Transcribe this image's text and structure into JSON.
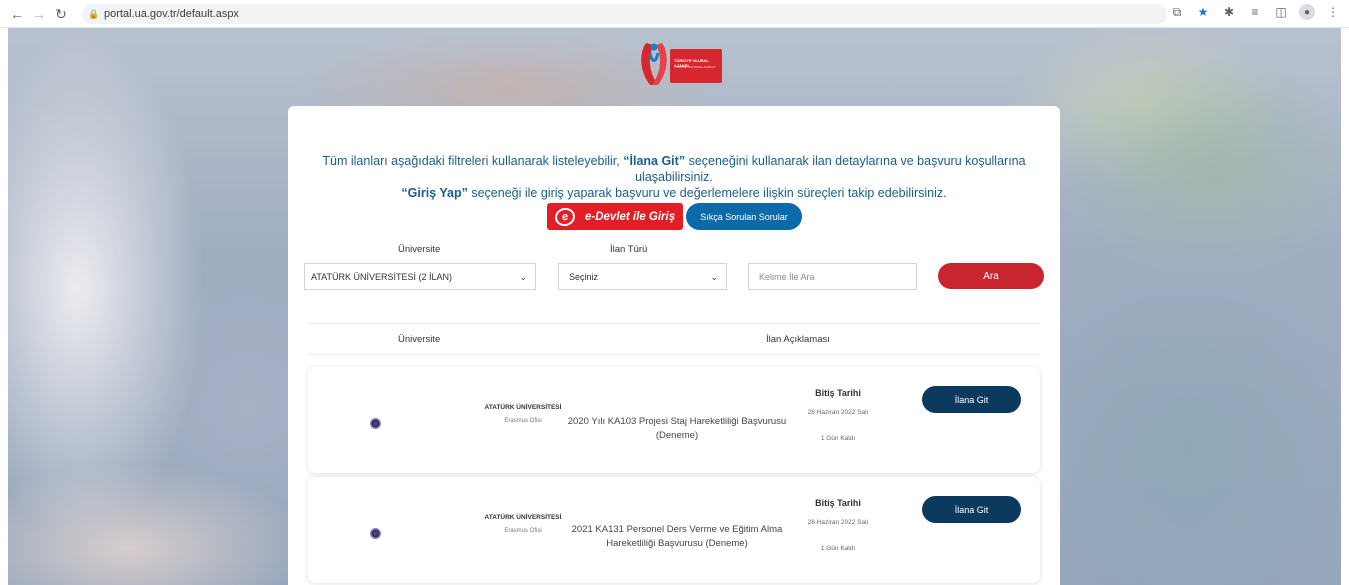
{
  "browser": {
    "url": "portal.ua.gov.tr/default.aspx",
    "icons": [
      "back-icon",
      "forward-icon",
      "reload-icon",
      "lock-icon",
      "share-icon",
      "star-icon",
      "extensions-icon",
      "reading-list-icon",
      "side-panel-icon",
      "profile-icon",
      "menu-icon"
    ]
  },
  "logo": {
    "line1": "TÜRKİYE ULUSAL AJANSI",
    "line2": "TURKISH NATIONAL AGENCY"
  },
  "intro": {
    "p1": "Tüm ilanları aşağıdaki filtreleri kullanarak listeleyebilir,",
    "p1_bold": "“İlana Git”",
    "p1_end": "seçeneğini kullanarak ilan detaylarına ve başvuru koşullarına ulaşabilirsiniz.",
    "p2_bold": "“Giriş Yap”",
    "p2_end": "seçeneği ile giriş yaparak başvuru ve değerlemelere ilişkin süreçleri takip edebilirsiniz."
  },
  "buttons": {
    "edevlet": "e-Devlet ile Giriş",
    "faq": "Sıkça Sorulan Sorular",
    "search": "Ara"
  },
  "filters": {
    "university_label": "Üniversite",
    "university_value": "ATATÜRK ÜNİVERSİTESİ (2 İLAN)",
    "type_label": "İlan Türü",
    "type_value": "Seçiniz",
    "keyword_placeholder": "Kelime İle Ara"
  },
  "table": {
    "col_university": "Üniversite",
    "col_description": "İlan Açıklaması",
    "rows": [
      {
        "university": "ATATÜRK ÜNİVERSİTESİ",
        "office": "Erasmus Ofisi",
        "description": "2020 Yılı KA103 Projesi Staj Hareketliliği Başvurusu (Deneme)",
        "deadline_label": "Bitiş Tarihi",
        "deadline_date": "28 Haziran 2022 Salı",
        "remaining": "1 Gün Kaldı",
        "button": "İlana Git"
      },
      {
        "university": "ATATÜRK ÜNİVERSİTESİ",
        "office": "Erasmus Ofisi",
        "description": "2021 KA131 Personel Ders Verme ve Eğitim Alma Hareketliliği Başvurusu (Deneme)",
        "deadline_label": "Bitiş Tarihi",
        "deadline_date": "28 Haziran 2022 Salı",
        "remaining": "1 Gün Kaldı",
        "button": "İlana Git"
      }
    ]
  },
  "colors": {
    "brand_red": "#e31e24",
    "faq_blue": "#0d6aa8",
    "go_navy": "#0c3a5e",
    "intro_blue": "#1a5d8f"
  }
}
